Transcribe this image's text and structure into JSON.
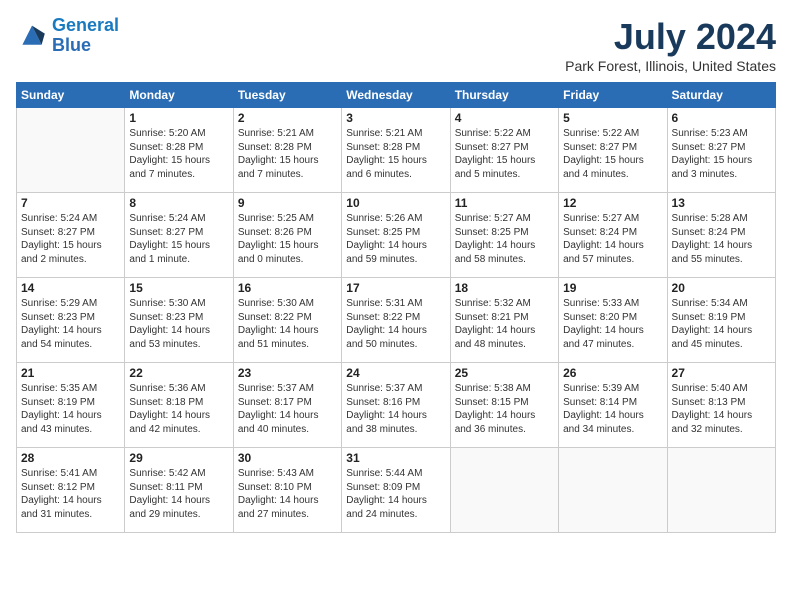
{
  "logo": {
    "line1": "General",
    "line2": "Blue"
  },
  "title": "July 2024",
  "location": "Park Forest, Illinois, United States",
  "days_of_week": [
    "Sunday",
    "Monday",
    "Tuesday",
    "Wednesday",
    "Thursday",
    "Friday",
    "Saturday"
  ],
  "weeks": [
    [
      {
        "day": null
      },
      {
        "day": "1",
        "sunrise": "5:20 AM",
        "sunset": "8:28 PM",
        "daylight": "15 hours and 7 minutes."
      },
      {
        "day": "2",
        "sunrise": "5:21 AM",
        "sunset": "8:28 PM",
        "daylight": "15 hours and 7 minutes."
      },
      {
        "day": "3",
        "sunrise": "5:21 AM",
        "sunset": "8:28 PM",
        "daylight": "15 hours and 6 minutes."
      },
      {
        "day": "4",
        "sunrise": "5:22 AM",
        "sunset": "8:27 PM",
        "daylight": "15 hours and 5 minutes."
      },
      {
        "day": "5",
        "sunrise": "5:22 AM",
        "sunset": "8:27 PM",
        "daylight": "15 hours and 4 minutes."
      },
      {
        "day": "6",
        "sunrise": "5:23 AM",
        "sunset": "8:27 PM",
        "daylight": "15 hours and 3 minutes."
      }
    ],
    [
      {
        "day": "7",
        "sunrise": "5:24 AM",
        "sunset": "8:27 PM",
        "daylight": "15 hours and 2 minutes."
      },
      {
        "day": "8",
        "sunrise": "5:24 AM",
        "sunset": "8:27 PM",
        "daylight": "15 hours and 1 minute."
      },
      {
        "day": "9",
        "sunrise": "5:25 AM",
        "sunset": "8:26 PM",
        "daylight": "15 hours and 0 minutes."
      },
      {
        "day": "10",
        "sunrise": "5:26 AM",
        "sunset": "8:25 PM",
        "daylight": "14 hours and 59 minutes."
      },
      {
        "day": "11",
        "sunrise": "5:27 AM",
        "sunset": "8:25 PM",
        "daylight": "14 hours and 58 minutes."
      },
      {
        "day": "12",
        "sunrise": "5:27 AM",
        "sunset": "8:24 PM",
        "daylight": "14 hours and 57 minutes."
      },
      {
        "day": "13",
        "sunrise": "5:28 AM",
        "sunset": "8:24 PM",
        "daylight": "14 hours and 55 minutes."
      }
    ],
    [
      {
        "day": "14",
        "sunrise": "5:29 AM",
        "sunset": "8:23 PM",
        "daylight": "14 hours and 54 minutes."
      },
      {
        "day": "15",
        "sunrise": "5:30 AM",
        "sunset": "8:23 PM",
        "daylight": "14 hours and 53 minutes."
      },
      {
        "day": "16",
        "sunrise": "5:30 AM",
        "sunset": "8:22 PM",
        "daylight": "14 hours and 51 minutes."
      },
      {
        "day": "17",
        "sunrise": "5:31 AM",
        "sunset": "8:22 PM",
        "daylight": "14 hours and 50 minutes."
      },
      {
        "day": "18",
        "sunrise": "5:32 AM",
        "sunset": "8:21 PM",
        "daylight": "14 hours and 48 minutes."
      },
      {
        "day": "19",
        "sunrise": "5:33 AM",
        "sunset": "8:20 PM",
        "daylight": "14 hours and 47 minutes."
      },
      {
        "day": "20",
        "sunrise": "5:34 AM",
        "sunset": "8:19 PM",
        "daylight": "14 hours and 45 minutes."
      }
    ],
    [
      {
        "day": "21",
        "sunrise": "5:35 AM",
        "sunset": "8:19 PM",
        "daylight": "14 hours and 43 minutes."
      },
      {
        "day": "22",
        "sunrise": "5:36 AM",
        "sunset": "8:18 PM",
        "daylight": "14 hours and 42 minutes."
      },
      {
        "day": "23",
        "sunrise": "5:37 AM",
        "sunset": "8:17 PM",
        "daylight": "14 hours and 40 minutes."
      },
      {
        "day": "24",
        "sunrise": "5:37 AM",
        "sunset": "8:16 PM",
        "daylight": "14 hours and 38 minutes."
      },
      {
        "day": "25",
        "sunrise": "5:38 AM",
        "sunset": "8:15 PM",
        "daylight": "14 hours and 36 minutes."
      },
      {
        "day": "26",
        "sunrise": "5:39 AM",
        "sunset": "8:14 PM",
        "daylight": "14 hours and 34 minutes."
      },
      {
        "day": "27",
        "sunrise": "5:40 AM",
        "sunset": "8:13 PM",
        "daylight": "14 hours and 32 minutes."
      }
    ],
    [
      {
        "day": "28",
        "sunrise": "5:41 AM",
        "sunset": "8:12 PM",
        "daylight": "14 hours and 31 minutes."
      },
      {
        "day": "29",
        "sunrise": "5:42 AM",
        "sunset": "8:11 PM",
        "daylight": "14 hours and 29 minutes."
      },
      {
        "day": "30",
        "sunrise": "5:43 AM",
        "sunset": "8:10 PM",
        "daylight": "14 hours and 27 minutes."
      },
      {
        "day": "31",
        "sunrise": "5:44 AM",
        "sunset": "8:09 PM",
        "daylight": "14 hours and 24 minutes."
      },
      {
        "day": null
      },
      {
        "day": null
      },
      {
        "day": null
      }
    ]
  ]
}
